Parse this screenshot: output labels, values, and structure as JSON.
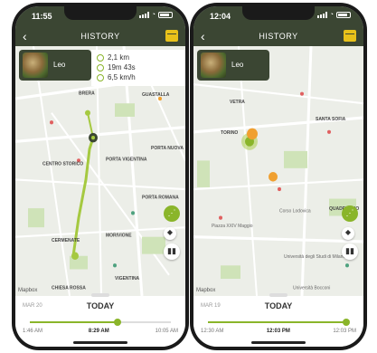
{
  "colors": {
    "header": "#3b4633",
    "accent": "#8ab52a",
    "poi_orange": "#f0a030"
  },
  "left": {
    "status_time": "11:55",
    "title": "HISTORY",
    "pet_name": "Leo",
    "stats": [
      {
        "icon": "route-icon",
        "value": "2,1 km"
      },
      {
        "icon": "timer-icon",
        "value": "19m 43s"
      },
      {
        "icon": "speed-icon",
        "value": "6,5 km/h"
      }
    ],
    "map_labels": [
      "BRERA",
      "GUASTALLA",
      "PORTA NUOVA",
      "PORTA VIGENTINA",
      "CENTRO STORICO",
      "CERMENATE",
      "CHIESA ROSSA",
      "MORIVIONE",
      "VIGENTINA",
      "PORTA ROMANA"
    ],
    "date_label": "MAR 20",
    "day_label": "TODAY",
    "ticks": [
      "1:46 AM",
      "8:29 AM",
      "10:05 AM"
    ],
    "selected_tick": 1,
    "slider_position": 0.62,
    "mapbox": "Mapbox"
  },
  "right": {
    "status_time": "12:04",
    "title": "HISTORY",
    "pet_name": "Leo",
    "map_labels": [
      "VETRA",
      "SANTA SOFIA",
      "QUADRONNO",
      "TORINO",
      "Università Bocconi",
      "Corso Lodovica",
      "Piazza XXIV Maggio",
      "Università degli Studi di Milano"
    ],
    "date_label": "MAR 19",
    "day_label": "TODAY",
    "ticks": [
      "12:30 AM",
      "12:03 PM",
      "12:03 PM"
    ],
    "selected_tick": 1,
    "slider_position": 0.98,
    "mapbox": "Mapbox"
  }
}
